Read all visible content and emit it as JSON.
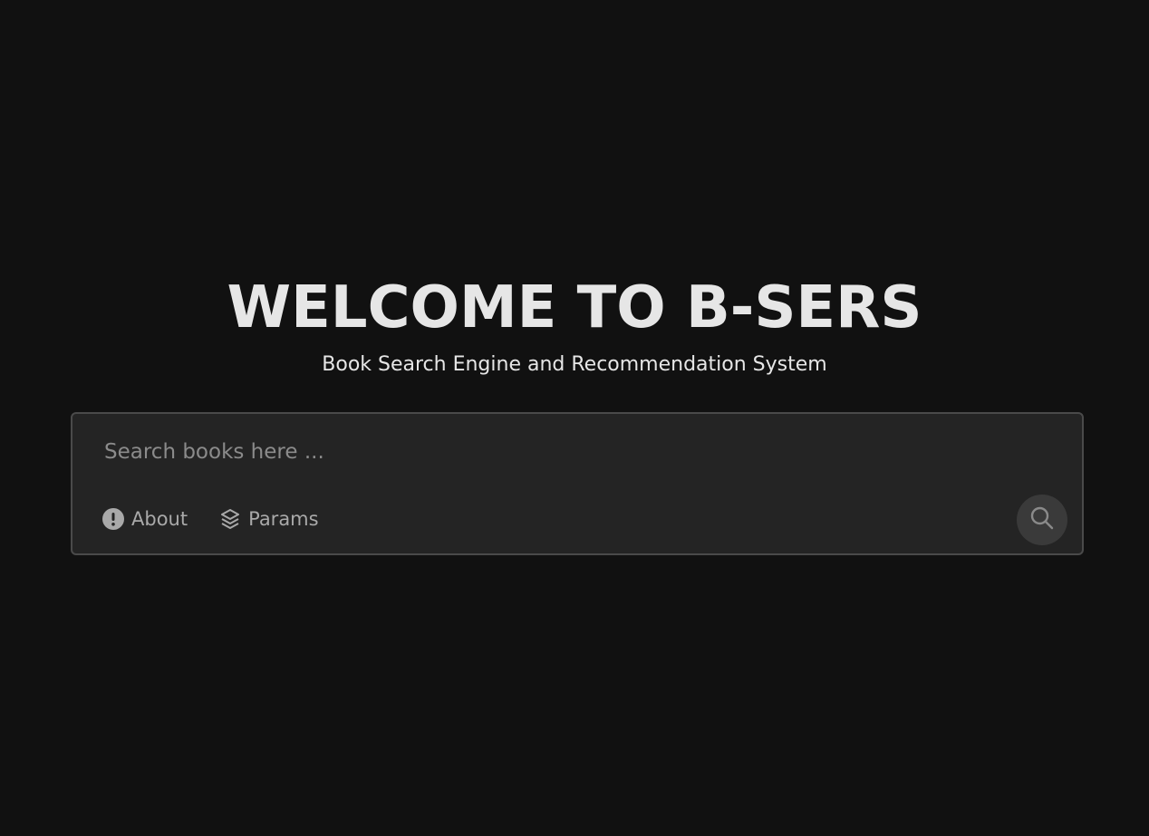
{
  "hero": {
    "title": "WELCOME TO B-SERS",
    "subtitle": "Book Search Engine and Recommendation System"
  },
  "search": {
    "placeholder": "Search books here ...",
    "value": "",
    "submit_icon": "search-icon"
  },
  "toolbar": {
    "about_label": "About",
    "about_icon": "info-exclamation-icon",
    "params_label": "Params",
    "params_icon": "layers-icon"
  },
  "colors": {
    "background": "#111111",
    "card": "#242424",
    "card_border": "#4a4a4a",
    "text": "#e6e6e6",
    "muted": "#a9a9a9"
  }
}
